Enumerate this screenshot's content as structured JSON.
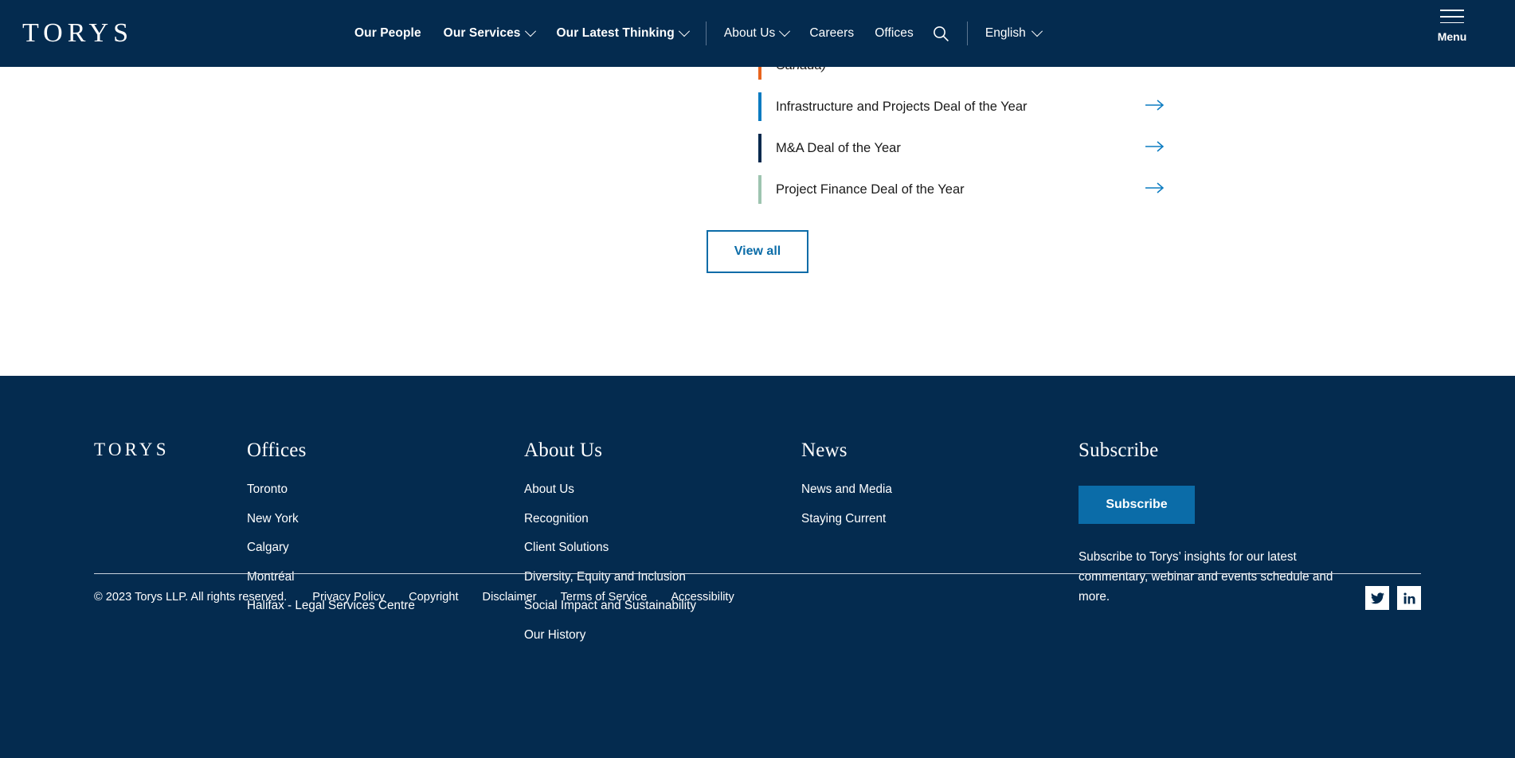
{
  "colors": {
    "navy": "#042B4F",
    "accent_blue": "#0B6CA8",
    "bar_orange": "#E8641E",
    "bar_blue": "#0B7BC1",
    "bar_navy": "#06294D",
    "bar_green": "#9EC4B0"
  },
  "header": {
    "brand": "TORYS",
    "primary_nav": [
      {
        "label": "Our People",
        "has_chevron": false
      },
      {
        "label": "Our Services",
        "has_chevron": true
      },
      {
        "label": "Our Latest Thinking",
        "has_chevron": true
      }
    ],
    "secondary_nav": [
      {
        "label": "About Us",
        "has_chevron": true
      },
      {
        "label": "Careers",
        "has_chevron": false
      },
      {
        "label": "Offices",
        "has_chevron": false
      }
    ],
    "search_icon": "search-icon",
    "language": {
      "label": "English",
      "has_chevron": true
    },
    "menu": {
      "label": "Menu",
      "icon": "hamburger-icon"
    }
  },
  "main": {
    "awards": [
      {
        "title": "Canada)",
        "italic": true,
        "bar_color": "#E8641E",
        "clipped": true
      },
      {
        "title": "Infrastructure and Projects Deal of the Year",
        "italic": false,
        "bar_color": "#0B7BC1",
        "clipped": false
      },
      {
        "title": "M&A Deal of the Year",
        "italic": false,
        "bar_color": "#06294D",
        "clipped": false
      },
      {
        "title": "Project Finance Deal of the Year",
        "italic": false,
        "bar_color": "#9EC4B0",
        "clipped": false
      }
    ],
    "view_all_label": "View all"
  },
  "footer": {
    "brand": "TORYS",
    "columns": [
      {
        "heading": "Offices",
        "links": [
          "Toronto",
          "New York",
          "Calgary",
          "Montréal",
          "Halifax - Legal Services Centre"
        ]
      },
      {
        "heading": "About Us",
        "links": [
          "About Us",
          "Recognition",
          "Client Solutions",
          "Diversity, Equity and Inclusion",
          "Social Impact and Sustainability",
          "Our History"
        ]
      },
      {
        "heading": "News",
        "links": [
          "News and Media",
          "Staying Current"
        ]
      }
    ],
    "subscribe": {
      "heading": "Subscribe",
      "button_label": "Subscribe",
      "description": "Subscribe to Torys’ insights for our latest commentary, webinar and events schedule and more."
    },
    "legal": {
      "copyright": "© 2023 Torys LLP. All rights reserved.",
      "links": [
        "Privacy Policy",
        "Copyright",
        "Disclaimer",
        "Terms of Service",
        "Accessibility"
      ]
    },
    "socials": [
      {
        "name": "twitter-icon"
      },
      {
        "name": "linkedin-icon"
      }
    ]
  }
}
